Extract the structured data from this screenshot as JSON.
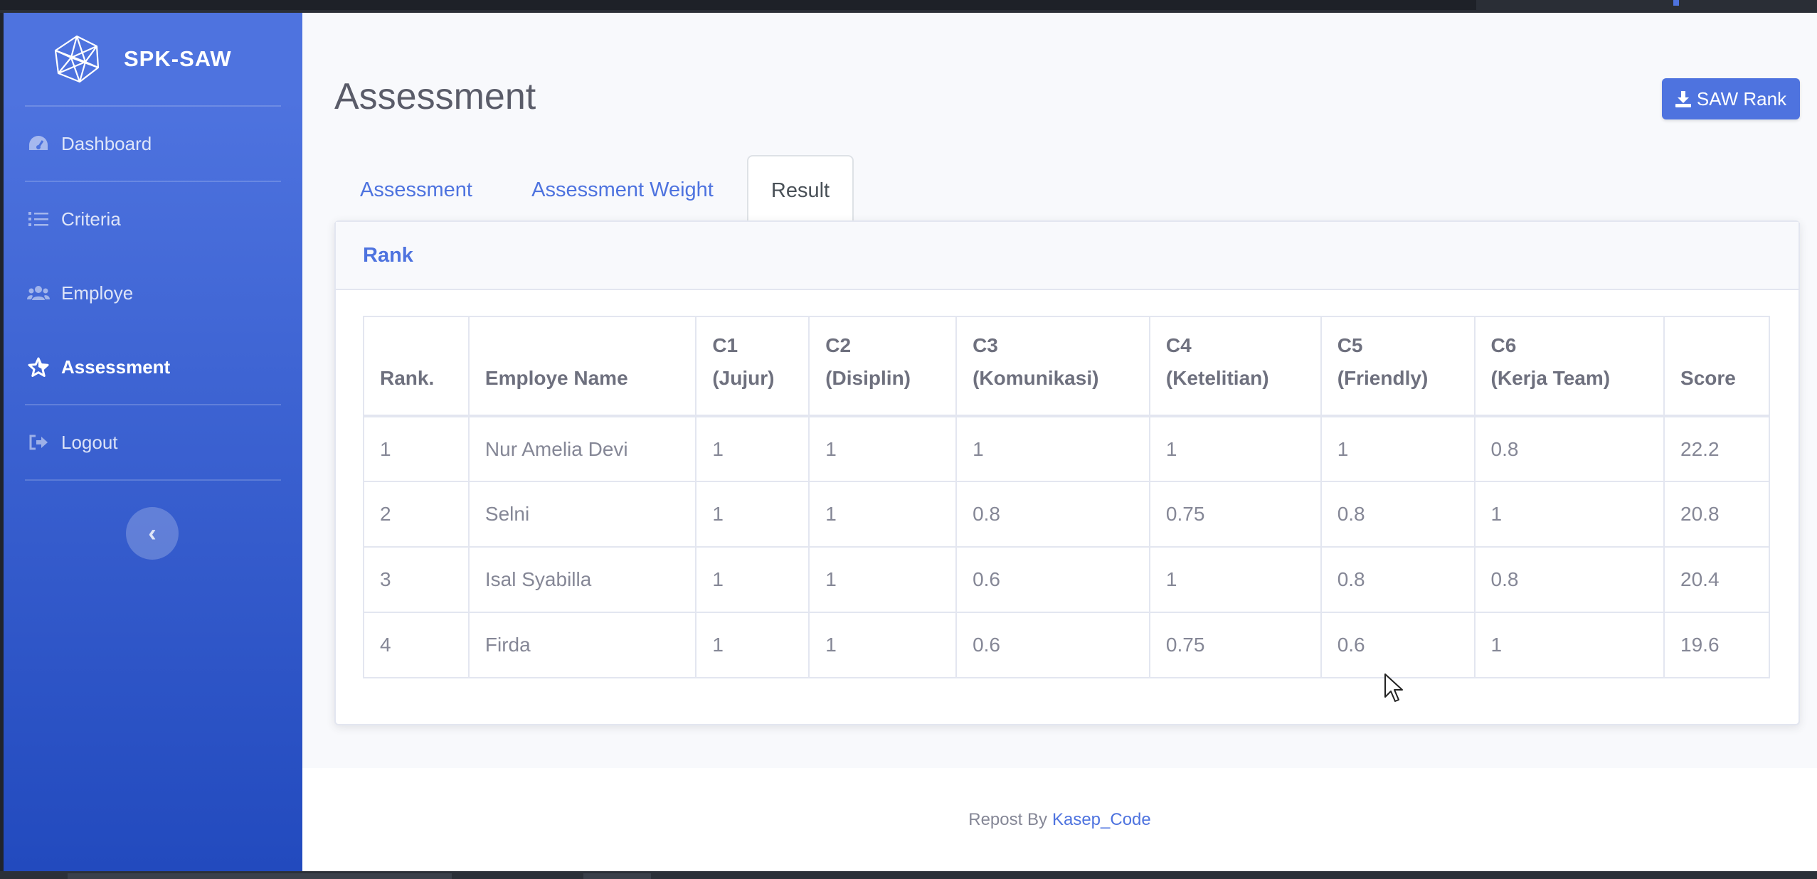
{
  "brand": {
    "name": "SPK-SAW",
    "logo_icon": "network-globe-icon"
  },
  "sidebar": {
    "items": [
      {
        "label": "Dashboard",
        "icon": "tachometer-icon",
        "active": false
      },
      {
        "label": "Criteria",
        "icon": "list-icon",
        "active": false
      },
      {
        "label": "Employe",
        "icon": "users-icon",
        "active": false
      },
      {
        "label": "Assessment",
        "icon": "star-icon",
        "active": true
      },
      {
        "label": "Logout",
        "icon": "sign-out-icon",
        "active": false
      }
    ],
    "toggle_glyph": "‹"
  },
  "header": {
    "title": "Assessment",
    "action_button": "SAW Rank",
    "action_icon": "download-icon"
  },
  "tabs": [
    {
      "label": "Assessment",
      "active": false
    },
    {
      "label": "Assessment Weight",
      "active": false
    },
    {
      "label": "Result",
      "active": true
    }
  ],
  "card": {
    "title": "Rank",
    "table": {
      "headers": [
        [
          "Rank."
        ],
        [
          "Employe Name"
        ],
        [
          "C1",
          "(Jujur)"
        ],
        [
          "C2",
          "(Disiplin)"
        ],
        [
          "C3",
          "(Komunikasi)"
        ],
        [
          "C4",
          "(Ketelitian)"
        ],
        [
          "C5",
          "(Friendly)"
        ],
        [
          "C6",
          "(Kerja Team)"
        ],
        [
          "Score"
        ]
      ],
      "rows": [
        [
          "1",
          "Nur Amelia Devi",
          "1",
          "1",
          "1",
          "1",
          "1",
          "0.8",
          "22.2"
        ],
        [
          "2",
          "Selni",
          "1",
          "1",
          "0.8",
          "0.75",
          "0.8",
          "1",
          "20.8"
        ],
        [
          "3",
          "Isal Syabilla",
          "1",
          "1",
          "0.6",
          "1",
          "0.8",
          "0.8",
          "20.4"
        ],
        [
          "4",
          "Firda",
          "1",
          "1",
          "0.6",
          "0.75",
          "0.6",
          "1",
          "19.6"
        ]
      ]
    }
  },
  "footer": {
    "prefix": "Repost By",
    "link": "Kasep_Code"
  },
  "colors": {
    "primary": "#4e73df",
    "sidebar_bottom": "#224abe",
    "text_muted": "#858796"
  }
}
